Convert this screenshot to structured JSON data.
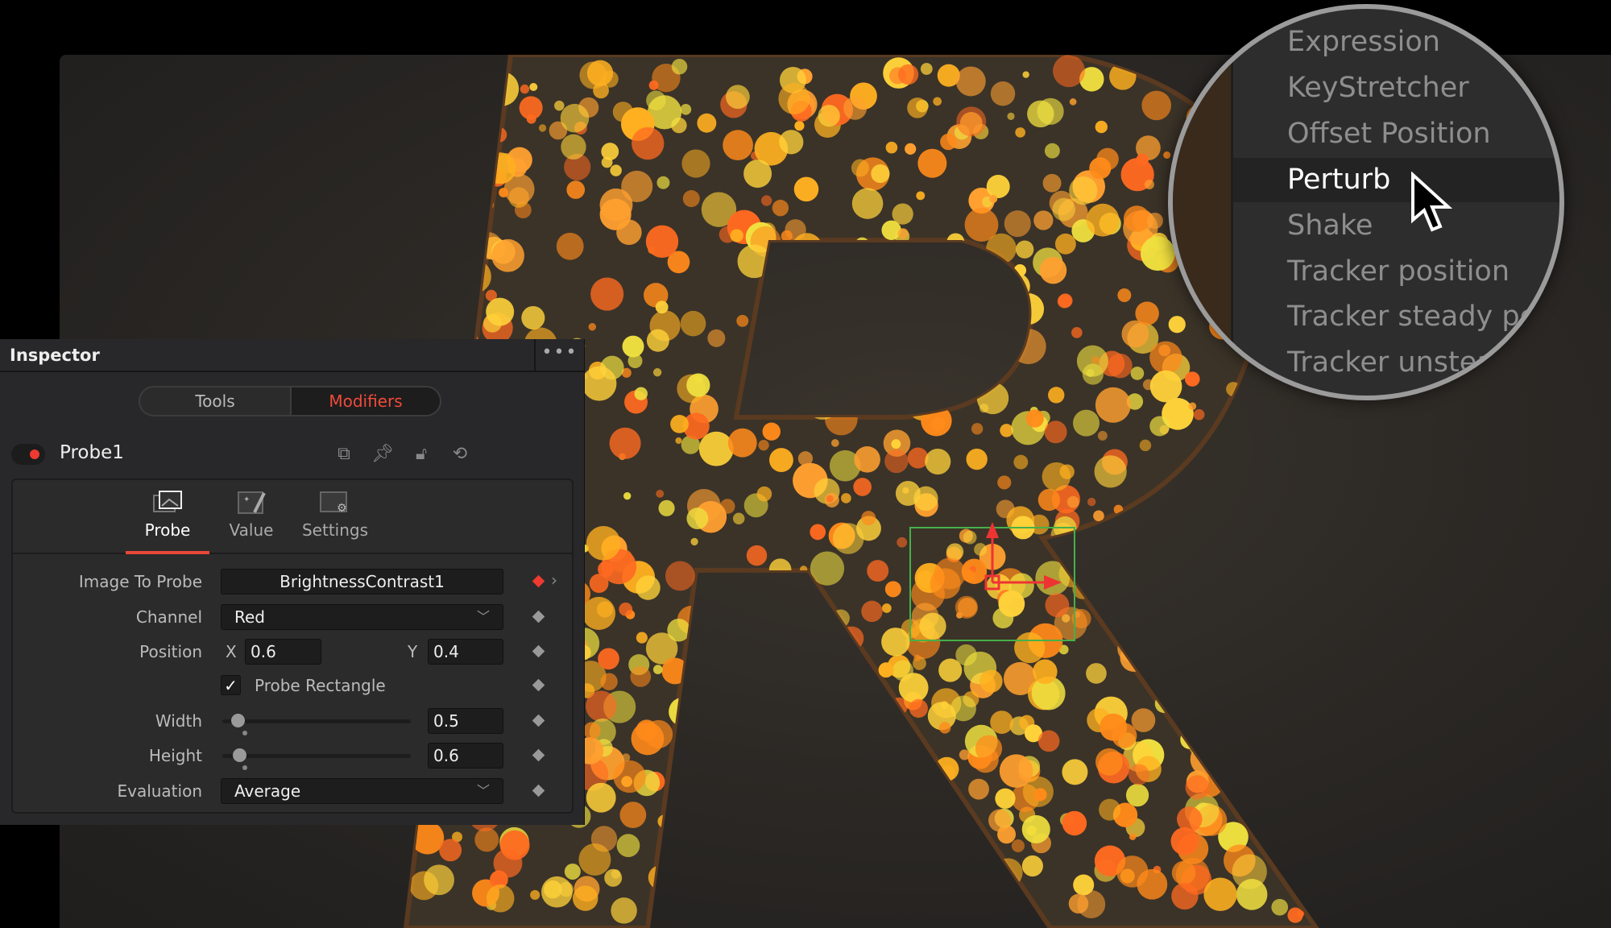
{
  "inspector": {
    "title": "Inspector",
    "menu_icon": "more-dots-icon",
    "tabs": [
      {
        "label": "Tools",
        "active": false
      },
      {
        "label": "Modifiers",
        "active": true
      }
    ],
    "node": {
      "name": "Probe1",
      "enabled": true,
      "icons": [
        "version-icon",
        "pin-icon",
        "lock-icon",
        "reset-icon"
      ]
    },
    "sub_tabs": [
      {
        "label": "Probe",
        "active": true
      },
      {
        "label": "Value",
        "active": false
      },
      {
        "label": "Settings",
        "active": false
      }
    ],
    "fields": {
      "image_to_probe": {
        "label": "Image To Probe",
        "value": "BrightnessContrast1"
      },
      "channel": {
        "label": "Channel",
        "value": "Red"
      },
      "position": {
        "label": "Position",
        "x_label": "X",
        "x": "0.6",
        "y_label": "Y",
        "y": "0.4"
      },
      "probe_rectangle": {
        "label": "Probe Rectangle",
        "checked": true
      },
      "width": {
        "label": "Width",
        "value": "0.5"
      },
      "height": {
        "label": "Height",
        "value": "0.6"
      },
      "evaluation": {
        "label": "Evaluation",
        "value": "Average"
      }
    }
  },
  "modifier_menu": {
    "items": [
      "Expression",
      "KeyStretcher",
      "Offset Position",
      "Perturb",
      "Shake",
      "Tracker position",
      "Tracker steady pos",
      "Tracker unstead"
    ],
    "highlighted": "Perturb"
  },
  "colors": {
    "accent": "#e8473a",
    "keyframe_active": "#ee3a30",
    "probe_rect": "#46b04a"
  }
}
